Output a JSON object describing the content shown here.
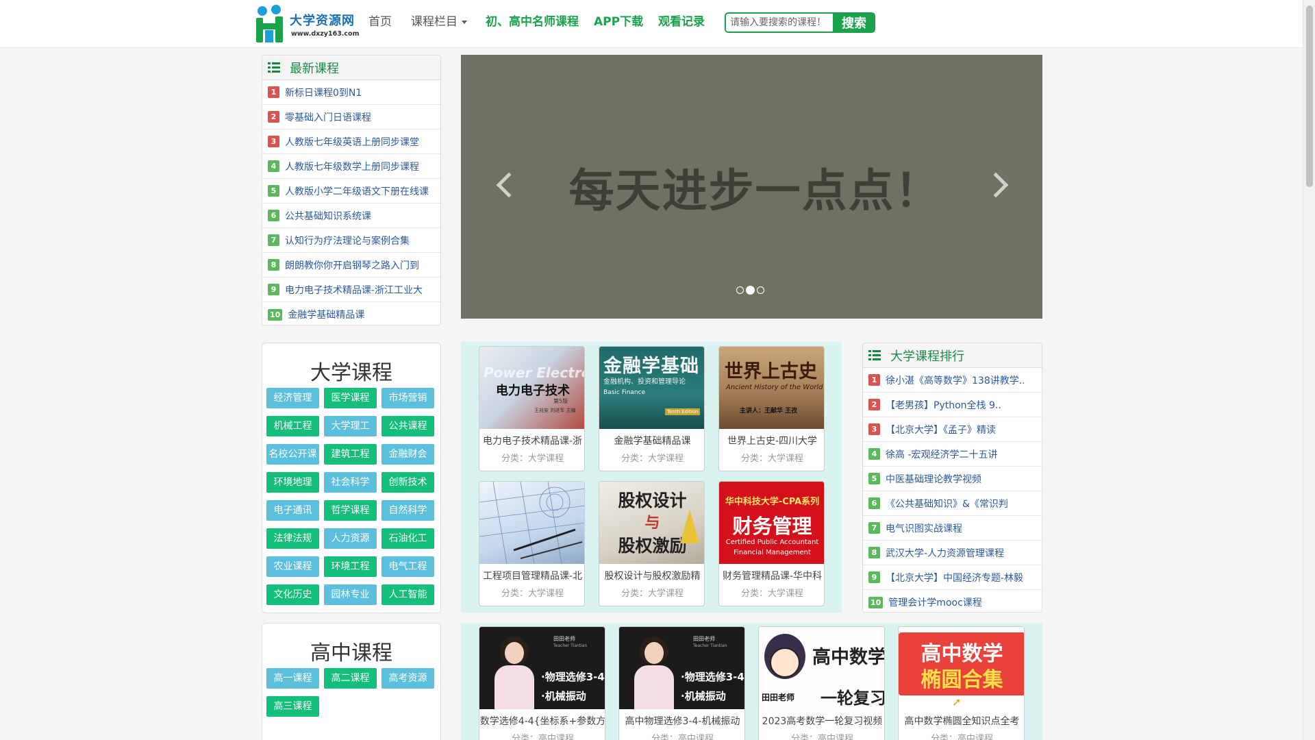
{
  "header": {
    "logo_name": "大学资源网",
    "logo_url": "www.dxzy163.com",
    "nav": {
      "home": "首页",
      "courses": "课程栏目",
      "highschool": "初、高中名师课程",
      "app": "APP下载",
      "history": "观看记录"
    },
    "search": {
      "placeholder": "请输入要搜索的课程！",
      "button": "搜索"
    }
  },
  "latest": {
    "title": "最新课程",
    "items": [
      {
        "num": "1",
        "text": "新标日课程0到N1"
      },
      {
        "num": "2",
        "text": "零基础入门日语课程"
      },
      {
        "num": "3",
        "text": "人教版七年级英语上册同步课堂"
      },
      {
        "num": "4",
        "text": "人教版七年级数学上册同步课程"
      },
      {
        "num": "5",
        "text": "人教版小学二年级语文下册在线课"
      },
      {
        "num": "6",
        "text": "公共基础知识系统课"
      },
      {
        "num": "7",
        "text": "认知行为疗法理论与案例合集"
      },
      {
        "num": "8",
        "text": "朗朗教你你开启钢琴之路入门到"
      },
      {
        "num": "9",
        "text": "电力电子技术精品课-浙江工业大"
      },
      {
        "num": "10",
        "text": "金融学基础精品课"
      }
    ]
  },
  "carousel": {
    "slide_text": "每天进步一点点！"
  },
  "university": {
    "title": "大学课程",
    "tags": [
      "经济管理",
      "医学课程",
      "市场营销",
      "机械工程",
      "大学理工",
      "公共课程",
      "名校公开课",
      "建筑工程",
      "金融财会",
      "环境地理",
      "社会科学",
      "创新技术",
      "电子通讯",
      "哲学课程",
      "自然科学",
      "法律法规",
      "人力资源",
      "石油化工",
      "农业课程",
      "环境工程",
      "电气工程",
      "文化历史",
      "园林专业",
      "人工智能"
    ]
  },
  "highschool": {
    "title": "高中课程",
    "tags": [
      "高一课程",
      "高二课程",
      "高考资源",
      "高三课程"
    ]
  },
  "uni_courses": [
    {
      "title": "电力电子技术精品课-浙",
      "cat": "分类：大学课程",
      "cover_title": "电力电子技术",
      "cover_sub": "Power Electronics",
      "cover_edition": "第5版",
      "cover_authors": "王兆安  刘进军  主编"
    },
    {
      "title": "金融学基础精品课",
      "cat": "分类：大学课程",
      "cover_title": "金融学基础",
      "cover_sub": "金融机构、投资和管理导论",
      "cover_en": "Basic Finance",
      "cover_edition": "Tenth Edition"
    },
    {
      "title": "世界上古史-四川大学",
      "cat": "分类：大学课程",
      "cover_title": "世界上古史",
      "cover_sub": "Ancient History of the World",
      "cover_speaker": "主讲人：王献华  王孜"
    },
    {
      "title": "工程项目管理精品课-北",
      "cat": "分类：大学课程"
    },
    {
      "title": "股权设计与股权激励精",
      "cat": "分类：大学课程",
      "cover_line1": "股权设计",
      "cover_line2": "与",
      "cover_line3": "股权激励"
    },
    {
      "title": "财务管理精品课-华中科",
      "cat": "分类：大学课程",
      "cover_top": "华中科技大学-CPA系列",
      "cover_title": "财务管理",
      "cover_en1": "Certified Public Accountant",
      "cover_en2": "Financial Management"
    }
  ],
  "uni_ranking": {
    "title": "大学课程排行",
    "items": [
      {
        "num": "1",
        "text": "徐小湛《高等数学》138讲教学.."
      },
      {
        "num": "2",
        "text": "【老男孩】Python全栈 9.."
      },
      {
        "num": "3",
        "text": "【北京大学】《孟子》精读"
      },
      {
        "num": "4",
        "text": "徐高 -宏观经济学二十五讲"
      },
      {
        "num": "5",
        "text": "中医基础理论教学视频"
      },
      {
        "num": "6",
        "text": "《公共基础知识》&《常识判"
      },
      {
        "num": "7",
        "text": "电气识图实战课程"
      },
      {
        "num": "8",
        "text": "武汉大学-人力资源管理课程"
      },
      {
        "num": "9",
        "text": "【北京大学】中国经济专题-林毅"
      },
      {
        "num": "10",
        "text": "管理会计学mooc课程"
      }
    ]
  },
  "hs_courses": [
    {
      "title": "数学选修4-4{坐标系+参数方",
      "cat": "分类：高中课程",
      "cover_brand": "田田老师",
      "cover_brand_en": "Teacher Tiantian",
      "cover_l1": "·物理选修3-4",
      "cover_l2": "·机械振动"
    },
    {
      "title": "高中物理选修3-4-机械振动",
      "cat": "分类：高中课程",
      "cover_brand": "田田老师",
      "cover_brand_en": "Teacher Tiantian",
      "cover_l1": "·物理选修3-4",
      "cover_l2": "·机械振动"
    },
    {
      "title": "2023高考数学一轮复习视频",
      "cat": "分类：高中课程",
      "cover_l1": "高中数学",
      "cover_l2": "一轮复习",
      "cover_brand": "田田老师"
    },
    {
      "title": "高中数学椭圆全知识点全考",
      "cat": "分类：高中课程",
      "cover_l1": "高中数学",
      "cover_l2": "椭圆合集"
    }
  ],
  "colors": {
    "brand_green": "#1aa34a",
    "rank_red": "#d9534f",
    "rank_green": "#5cb85c",
    "tag_blue": "#5bc0de",
    "tag_green": "#13bf7a",
    "link_blue": "#2a5aa0",
    "carousel_bg": "#6f7262",
    "grid_bg": "#d9f3f1"
  }
}
